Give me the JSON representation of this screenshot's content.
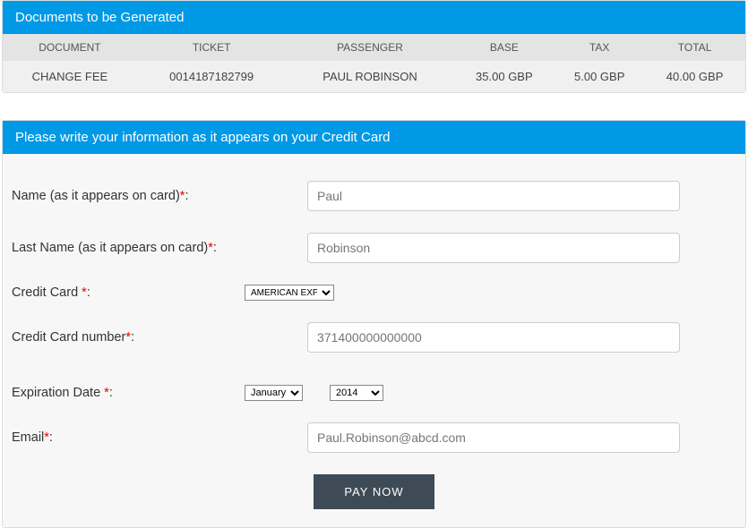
{
  "documents_panel": {
    "title": "Documents to be Generated",
    "columns": [
      "DOCUMENT",
      "TICKET",
      "PASSENGER",
      "BASE",
      "TAX",
      "TOTAL"
    ],
    "row": {
      "document": "CHANGE FEE",
      "ticket": "0014187182799",
      "passenger": "PAUL ROBINSON",
      "base": "35.00 GBP",
      "tax": "5.00 GBP",
      "total": "40.00 GBP"
    }
  },
  "cc_panel": {
    "title": "Please write your information as it appears on your Credit Card"
  },
  "form": {
    "name_label": "Name (as it appears on card)",
    "name_value": "Paul",
    "lastname_label": "Last Name (as it appears on card)",
    "lastname_value": "Robinson",
    "cc_label": "Credit Card ",
    "cc_value": "AMERICAN EXPRESS",
    "ccnum_label": "Credit Card number",
    "ccnum_value": "371400000000000",
    "exp_label": "Expiration Date ",
    "exp_month": "January",
    "exp_year": "2014",
    "email_label": "Email",
    "email_value": "Paul.Robinson@abcd.com",
    "colon": ":",
    "req": "*",
    "pay_label": "PAY NOW"
  }
}
